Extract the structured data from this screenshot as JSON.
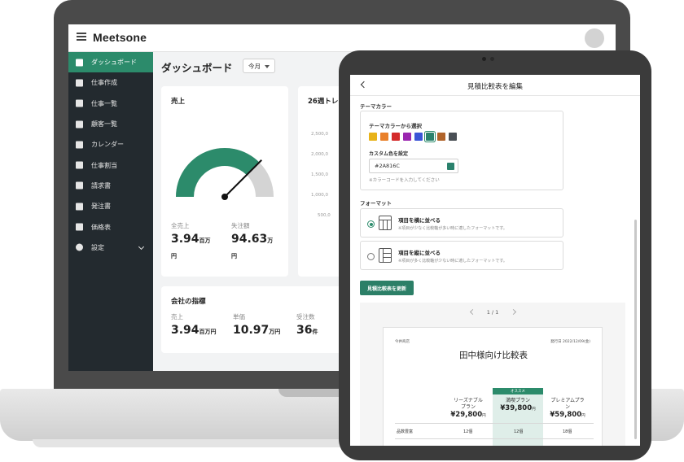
{
  "laptop": {
    "logo": "Meetsone",
    "sidebar": {
      "items": [
        {
          "label": "ダッシュボード",
          "icon": "dashboard-icon"
        },
        {
          "label": "仕事作成",
          "icon": "briefcase-plus-icon"
        },
        {
          "label": "仕事一覧",
          "icon": "briefcase-icon"
        },
        {
          "label": "顧客一覧",
          "icon": "contact-card-icon"
        },
        {
          "label": "カレンダー",
          "icon": "calendar-icon"
        },
        {
          "label": "仕事割当",
          "icon": "truck-icon"
        },
        {
          "label": "請求書",
          "icon": "invoice-icon"
        },
        {
          "label": "発注書",
          "icon": "order-icon"
        },
        {
          "label": "価格表",
          "icon": "tag-icon"
        },
        {
          "label": "設定",
          "icon": "gear-icon"
        }
      ]
    },
    "main": {
      "title": "ダッシュボード",
      "period": "今月",
      "sales_card": {
        "title": "売上",
        "gauge_fill_fraction": 0.75,
        "gauge_color": "#2c8b6b",
        "total_sales_label": "全売上",
        "total_sales_value": "3.94",
        "total_sales_unit": "百万",
        "total_sales_unit2": "円",
        "unordered_label": "失注額",
        "unordered_value": "94.63",
        "unordered_unit": "万",
        "unordered_unit2": "円"
      },
      "trend_card": {
        "title": "26週トレ",
        "y_ticks": [
          "2,500,0",
          "2,000,0",
          "1,500,0",
          "1,000,0",
          "500,0"
        ]
      },
      "kpi_card": {
        "title": "会社の指標",
        "sales_label": "売上",
        "sales_value": "3.94",
        "sales_unit": "百万円",
        "unit_price_label": "単価",
        "unit_price_value": "10.97",
        "unit_price_unit": "万円",
        "orders_label": "受注数",
        "orders_value": "36",
        "orders_unit": "件"
      }
    }
  },
  "tablet": {
    "header_title": "見積比較表を編集",
    "theme": {
      "section_label": "テーマカラー",
      "picker_label": "テーマカラーから選択",
      "swatches": [
        "#e8b31a",
        "#e9802a",
        "#d42a2a",
        "#9b27b0",
        "#3b55d6",
        "#2a816c",
        "#b0632a",
        "#4a4f55"
      ],
      "selected_index": 5,
      "custom_label": "カスタム色を設定",
      "custom_value": "#2A816C",
      "custom_hint": "※カラーコードを入力してください"
    },
    "format": {
      "section_label": "フォーマット",
      "options": [
        {
          "title": "項目を横に並べる",
          "sub": "※項目が少なく比較軸が多い時に適したフォーマットです。",
          "checked": true
        },
        {
          "title": "項目を縦に並べる",
          "sub": "※項目が多く比較軸が少ない時に適したフォーマットです。",
          "checked": false
        }
      ]
    },
    "update_button": "見積比較表を更新",
    "preview": {
      "pager": "1 / 1",
      "doc_left_small": "今井商店",
      "doc_right_small": "発行日 2022/12/09(金)",
      "doc_title": "田中様向け比較表",
      "recommended_badge": "オススメ",
      "plans": [
        {
          "name1": "リーズナブル",
          "name2": "プラン",
          "price": "¥29,800",
          "unit": "円",
          "count": "12個"
        },
        {
          "name1": "満喫プラン",
          "name2": "",
          "price": "¥39,800",
          "unit": "円",
          "count": "12個"
        },
        {
          "name1": "プレミアムプラ",
          "name2": "ン",
          "price": "¥59,800",
          "unit": "円",
          "count": "18個"
        }
      ],
      "row_label": "品数豊富"
    }
  }
}
